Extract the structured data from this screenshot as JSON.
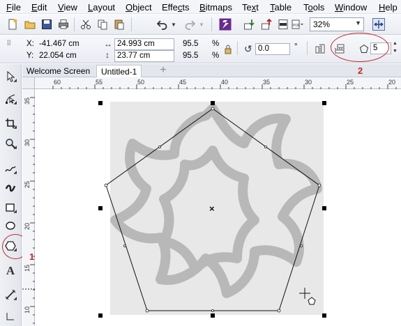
{
  "menu": {
    "items": [
      {
        "pre": "",
        "u": "F",
        "post": "ile"
      },
      {
        "pre": "",
        "u": "E",
        "post": "dit"
      },
      {
        "pre": "",
        "u": "V",
        "post": "iew"
      },
      {
        "pre": "",
        "u": "L",
        "post": "ayout"
      },
      {
        "pre": "",
        "u": "O",
        "post": "bject"
      },
      {
        "pre": "Effe",
        "u": "c",
        "post": "ts"
      },
      {
        "pre": "",
        "u": "B",
        "post": "itmaps"
      },
      {
        "pre": "Te",
        "u": "x",
        "post": "t"
      },
      {
        "pre": "",
        "u": "T",
        "post": "able"
      },
      {
        "pre": "T",
        "u": "o",
        "post": "ols"
      },
      {
        "pre": "",
        "u": "W",
        "post": "indow"
      },
      {
        "pre": "",
        "u": "H",
        "post": "elp"
      }
    ]
  },
  "toolbar": {
    "zoom_value": "32%"
  },
  "property_bar": {
    "x_label": "X:",
    "x_value": "-41.467 cm",
    "y_label": "Y:",
    "y_value": "22.054 cm",
    "width_value": "24.993 cm",
    "height_value": "23.77 cm",
    "scale_w": "95.5",
    "scale_h": "95.5",
    "percent_w": "%",
    "percent_h": "%",
    "rotation_value": "0.0",
    "degree_symbol": "°",
    "polygon_sides": "5"
  },
  "annotations": {
    "callout_1": "1",
    "callout_2": "2",
    "accent_color": "#c0282d"
  },
  "tabs": {
    "welcome": "Welcome Screen",
    "untitled": "Untitled-1",
    "add": "+"
  },
  "rulers": {
    "horizontal": [
      "60",
      "55",
      "50",
      "45",
      "40",
      "35",
      "30",
      "25",
      "20"
    ],
    "vertical": [
      "35",
      "30",
      "25",
      "20",
      "15",
      "10"
    ]
  },
  "canvas": {
    "center_marker": "×",
    "image_bg_color": "#e8e8e8",
    "motif_color": "#b8b8b8"
  }
}
